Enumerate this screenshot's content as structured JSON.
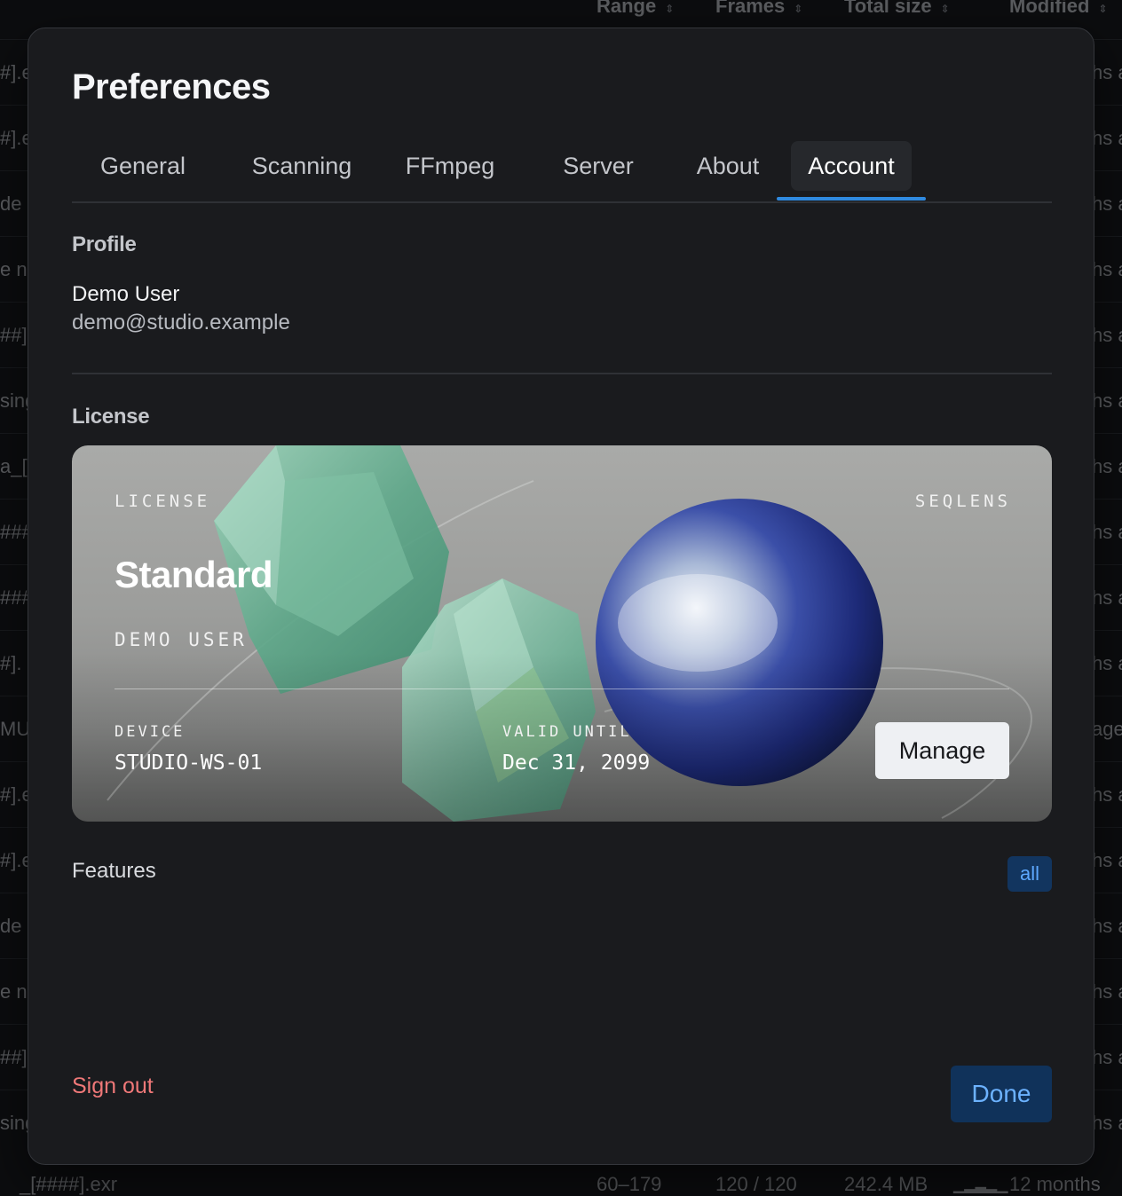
{
  "background": {
    "columns": [
      "Range",
      "Frames",
      "Total size",
      "Modified"
    ],
    "row_left": [
      "#].e",
      "#].e",
      "de",
      "e n",
      "##].",
      "sing",
      "a_[",
      "###",
      "###",
      "#].",
      "MU",
      "#].e",
      "#].e",
      "de",
      "e n",
      "##].",
      "sing"
    ],
    "row_right": [
      "hs a",
      "hs a",
      "hs a",
      "hs a",
      "hs a",
      "hs a",
      "hs a",
      "hs a",
      "hs a",
      "hs a",
      "age",
      "hs a",
      "hs a",
      "hs a",
      "hs a",
      "hs a",
      "hs a"
    ],
    "footer": {
      "name": "_[####].exr",
      "range": "60–179",
      "frames": "120 / 120",
      "size": "242.4 MB",
      "modified": "12 months"
    }
  },
  "modal": {
    "title": "Preferences",
    "tabs": [
      "General",
      "Scanning",
      "FFmpeg",
      "Server",
      "About",
      "Account"
    ],
    "active_tab": "Account",
    "profile": {
      "heading": "Profile",
      "name": "Demo User",
      "email": "demo@studio.example"
    },
    "license": {
      "heading": "License",
      "card": {
        "kicker": "LICENSE",
        "brand": "SEQLENS",
        "tier": "Standard",
        "holder": "DEMO USER",
        "device_label": "DEVICE",
        "device": "STUDIO-WS-01",
        "valid_label": "VALID UNTIL",
        "valid_until": "Dec 31, 2099",
        "manage_label": "Manage"
      }
    },
    "features": {
      "label": "Features",
      "badge": "all"
    },
    "sign_out": "Sign out",
    "done": "Done"
  },
  "colors": {
    "accent": "#2f8ae0",
    "danger": "#f07878",
    "primary_button_bg": "#10325a",
    "primary_button_text": "#6cb2ff"
  }
}
